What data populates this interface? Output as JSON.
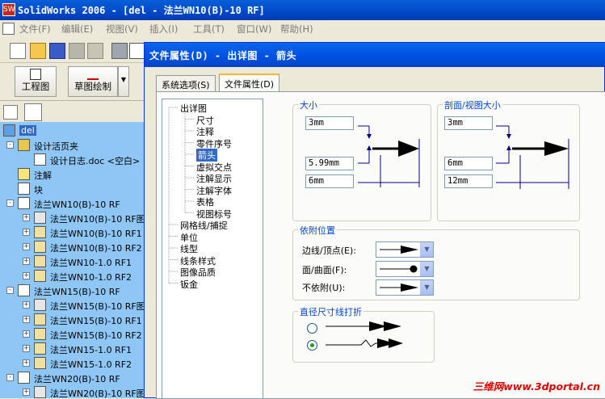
{
  "window": {
    "title": "SolidWorks 2006 - [del - 法兰WN10(B)-10 RF]"
  },
  "menu": [
    "文件(F)",
    "编辑(E)",
    "视图(V)",
    "插入(I)",
    "工具(T)",
    "窗口(W)",
    "帮助(H)"
  ],
  "toolbar": {
    "drawing_label": "工程图",
    "sketch_label": "草图绘制"
  },
  "tree": {
    "items": [
      {
        "label": "del",
        "level": 0,
        "expand": "",
        "icon": "drawing-icon",
        "selected": true
      },
      {
        "label": "设计活页夹",
        "level": 1,
        "expand": "-",
        "icon": "binder-icon"
      },
      {
        "label": "设计日志.doc <空白>",
        "level": 2,
        "expand": "",
        "icon": "document-icon"
      },
      {
        "label": "注解",
        "level": 1,
        "expand": "",
        "icon": "annotation-icon"
      },
      {
        "label": "块",
        "level": 1,
        "expand": "",
        "icon": "block-icon"
      },
      {
        "label": "法兰WN10(B)-10 RF",
        "level": 1,
        "expand": "-",
        "icon": "sheet-icon"
      },
      {
        "label": "法兰WN10(B)-10 RF图",
        "level": 2,
        "expand": "+",
        "icon": "view-icon"
      },
      {
        "label": "法兰WN10(B)-10 RF1",
        "level": 2,
        "expand": "+",
        "icon": "part-view-icon"
      },
      {
        "label": "法兰WN10(B)-10 RF2",
        "level": 2,
        "expand": "+",
        "icon": "part-view-icon"
      },
      {
        "label": "法兰WN10-1.0 RF1",
        "level": 2,
        "expand": "+",
        "icon": "part-view-icon"
      },
      {
        "label": "法兰WN10-1.0 RF2",
        "level": 2,
        "expand": "+",
        "icon": "part-view-icon"
      },
      {
        "label": "法兰WN15(B)-10 RF",
        "level": 1,
        "expand": "-",
        "icon": "sheet-icon"
      },
      {
        "label": "法兰WN15(B)-10 RF图",
        "level": 2,
        "expand": "+",
        "icon": "view-icon"
      },
      {
        "label": "法兰WN15(B)-10 RF1",
        "level": 2,
        "expand": "+",
        "icon": "part-view-icon"
      },
      {
        "label": "法兰WN15(B)-10 RF2",
        "level": 2,
        "expand": "+",
        "icon": "part-view-icon"
      },
      {
        "label": "法兰WN15-1.0 RF1",
        "level": 2,
        "expand": "+",
        "icon": "part-view-icon"
      },
      {
        "label": "法兰WN15-1.0 RF2",
        "level": 2,
        "expand": "+",
        "icon": "part-view-icon"
      },
      {
        "label": "法兰WN20(B)-10 RF",
        "level": 1,
        "expand": "-",
        "icon": "sheet-icon"
      },
      {
        "label": "法兰WN20(B)-10 RF图",
        "level": 2,
        "expand": "+",
        "icon": "view-icon"
      }
    ]
  },
  "dialog": {
    "title": "文件属性(D) - 出详图 - 箭头",
    "tabs": [
      {
        "label": "系统选项(S)",
        "active": false
      },
      {
        "label": "文件属性(D)",
        "active": true
      }
    ],
    "categories": [
      {
        "label": "出详图",
        "level": 0
      },
      {
        "label": "尺寸",
        "level": 1
      },
      {
        "label": "注释",
        "level": 1
      },
      {
        "label": "零件序号",
        "level": 1
      },
      {
        "label": "箭头",
        "level": 1,
        "selected": true
      },
      {
        "label": "虚拟交点",
        "level": 1
      },
      {
        "label": "注解显示",
        "level": 1
      },
      {
        "label": "注解字体",
        "level": 1
      },
      {
        "label": "表格",
        "level": 1
      },
      {
        "label": "视图标号",
        "level": 1
      },
      {
        "label": "网格线/捕捉",
        "level": 0
      },
      {
        "label": "单位",
        "level": 0
      },
      {
        "label": "线型",
        "level": 0
      },
      {
        "label": "线条样式",
        "level": 0
      },
      {
        "label": "图像品质",
        "level": 0
      },
      {
        "label": "钣金",
        "level": 0
      }
    ],
    "size_group": {
      "title": "大小",
      "height": "3mm",
      "width": "5.99mm",
      "length": "6mm"
    },
    "section_group": {
      "title": "剖面/视图大小",
      "height": "3mm",
      "width": "6mm",
      "length": "12mm"
    },
    "attach_group": {
      "title": "依附位置",
      "rows": [
        {
          "label": "边线/顶点(E):",
          "style": "solid-arrow"
        },
        {
          "label": "面/曲面(F):",
          "style": "dot"
        },
        {
          "label": "不依附(U):",
          "style": "solid-arrow"
        }
      ]
    },
    "break_group": {
      "title": "直径尺寸线打折",
      "option1_selected": false,
      "option2_selected": true
    }
  },
  "watermark": "三维网www.3dportal.cn"
}
